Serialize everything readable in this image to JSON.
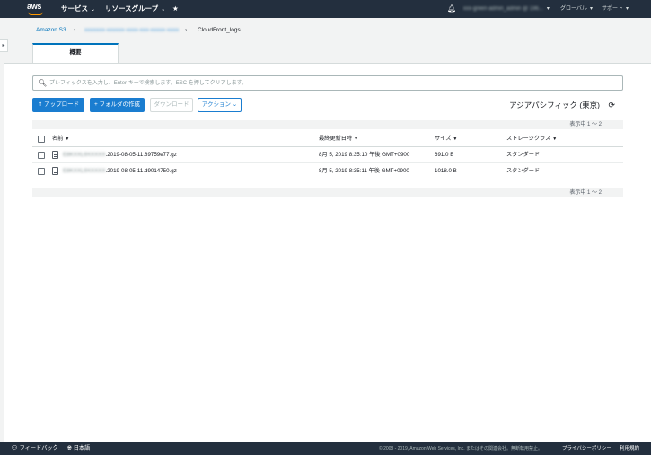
{
  "nav": {
    "logo_text": "aws",
    "services": "サービス",
    "resource_groups": "リソースグループ",
    "pin_icon": "★",
    "bell_icon": "bell-icon",
    "account": "xxx-green-admin_admin @ 196...",
    "region": "グローバル",
    "support": "サポート"
  },
  "breadcrumb": {
    "root": "Amazon S3",
    "bucket": "xxxxxxx-xxxxxx-xxxx-xxx-xxxxx-xxxx",
    "folder": "CloudFront_logs",
    "separator": "›"
  },
  "tabs": [
    {
      "label": "概要"
    }
  ],
  "search": {
    "placeholder": "プレフィックスを入力し、Enter キーで検索します。ESC を押してクリアします。"
  },
  "toolbar": {
    "upload": "アップロード",
    "create_folder": "フォルダの作成",
    "download": "ダウンロード",
    "actions": "アクション",
    "region_label": "アジアパシフィック (東京)"
  },
  "pager_text": "表示中 1 ～ 2",
  "table": {
    "headers": {
      "name": "名前",
      "modified": "最終更新日時",
      "size": "サイズ",
      "storage": "ストレージクラス"
    },
    "rows": [
      {
        "prefix": "E8KXXL9XXXXX",
        "name_suffix": ".2019-08-05-11.89759e77.gz",
        "modified": "8月 5, 2019 8:35:10 午後 GMT+0900",
        "size": "691.0 B",
        "storage": "スタンダード"
      },
      {
        "prefix": "E8KXXL9XXXXX",
        "name_suffix": ".2019-08-05-11.d9014750.gz",
        "modified": "8月 5, 2019 8:35:11 午後 GMT+0900",
        "size": "1018.0 B",
        "storage": "スタンダード"
      }
    ]
  },
  "footer": {
    "feedback": "フィードバック",
    "language": "日本語",
    "copyright": "© 2008 - 2019, Amazon Web Services, Inc. またはその関連会社。無断転用禁止。",
    "privacy": "プライバシーポリシー",
    "terms": "利用規約"
  },
  "colors": {
    "nav_bg": "#232f3e",
    "accent": "#1a7dd0",
    "link": "#0073bb",
    "logo_orange": "#ff9900"
  }
}
